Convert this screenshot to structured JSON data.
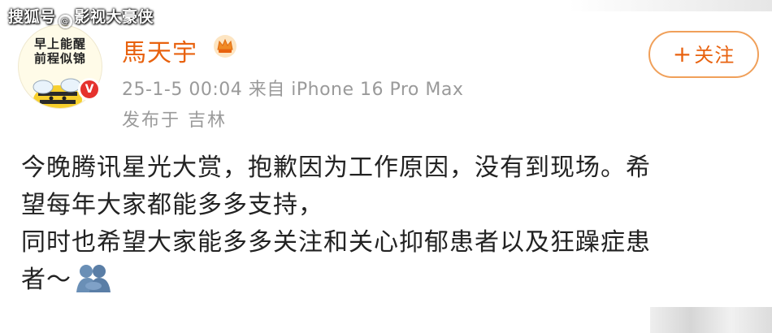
{
  "watermark": {
    "prefix": "搜狐号",
    "handle": "影视大豪侠"
  },
  "avatar": {
    "text_line1": "早上能醒",
    "text_line2": "前程似锦"
  },
  "verified_badge": "V",
  "user": {
    "name": "馬天宇"
  },
  "post": {
    "meta": "25-1-5 00:04  来自 iPhone 16 Pro Max",
    "location": "发布于 吉林",
    "line1": "今晚腾讯星光大赏，抱歉因为工作原因，没有到现场。希",
    "line2": "望每年大家都能多多支持，",
    "line3": "同时也希望大家能多多关注和关心抑郁患者以及狂躁症患",
    "line4": "者～"
  },
  "follow_button": {
    "plus": "+",
    "label": "关注"
  },
  "colors": {
    "accent": "#e8620f",
    "button_border": "#f0a05a",
    "meta": "#9a9a9a",
    "badge": "#e5322d"
  },
  "icons": [
    "crown-icon",
    "hug-emoji-icon",
    "verified-icon"
  ]
}
